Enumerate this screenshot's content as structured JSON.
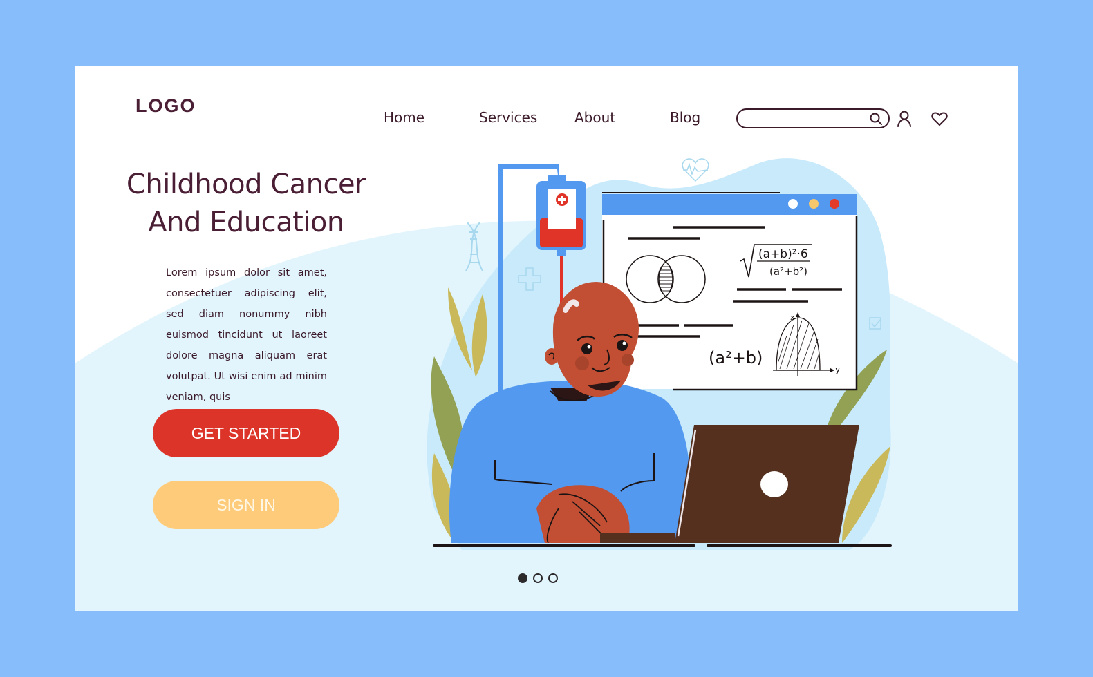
{
  "header": {
    "logo": "LOGO",
    "nav": [
      {
        "label": "Home"
      },
      {
        "label": "Services"
      },
      {
        "label": "About"
      },
      {
        "label": "Blog"
      }
    ],
    "search": {
      "value": "",
      "placeholder": "",
      "icon": "search-icon"
    },
    "icons": [
      "user-icon",
      "heart-icon"
    ]
  },
  "hero": {
    "title_line1": "Childhood Cancer",
    "title_line2": "And Education",
    "body": "Lorem ipsum dolor sit amet, consectetuer adipiscing elit, sed diam nonummy nibh euismod tincidunt ut laoreet dolore magna aliquam erat volutpat. Ut wisi enim ad minim veniam, quis",
    "primary_button": "GET STARTED",
    "secondary_button": "SIGN IN"
  },
  "illustration": {
    "formula_sqrt_numerator": "(a+b)²·6",
    "formula_sqrt_denominator": "(a²+b²)",
    "formula_expression": "(a²+b)",
    "graph_x_label": "x",
    "graph_y_label": "y",
    "window_dot_colors": [
      "#ffffff",
      "#f7c76b",
      "#e23a2b"
    ]
  },
  "carousel": {
    "total": 3,
    "active_index": 0
  },
  "colors": {
    "page_bg": "#88bdfc",
    "accent_red": "#dc3429",
    "accent_yellow": "#fecb7a",
    "text_dark": "#4a1e34",
    "illustration_blue": "#5499f0"
  }
}
